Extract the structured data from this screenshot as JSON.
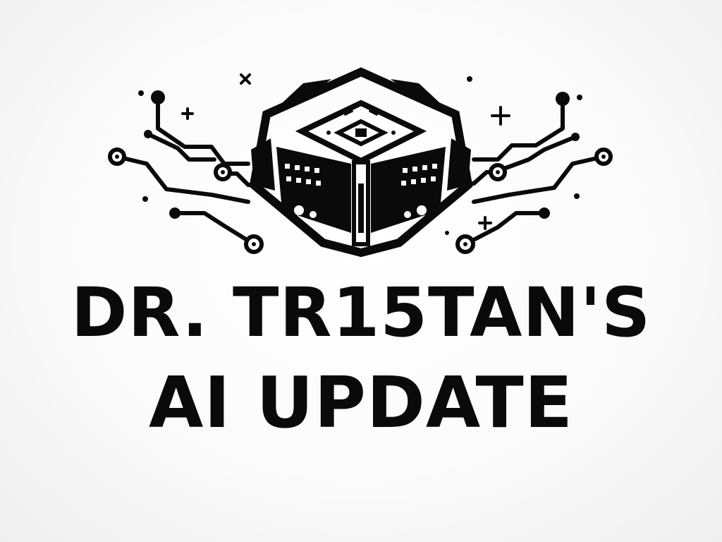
{
  "logo": {
    "icon": "circuit-processor-icon",
    "title_line_1": "DR. TR15TAN'S",
    "title_line_2": "AI UPDATE"
  },
  "colors": {
    "ink": "#0a0a0a",
    "background": "#ffffff"
  }
}
